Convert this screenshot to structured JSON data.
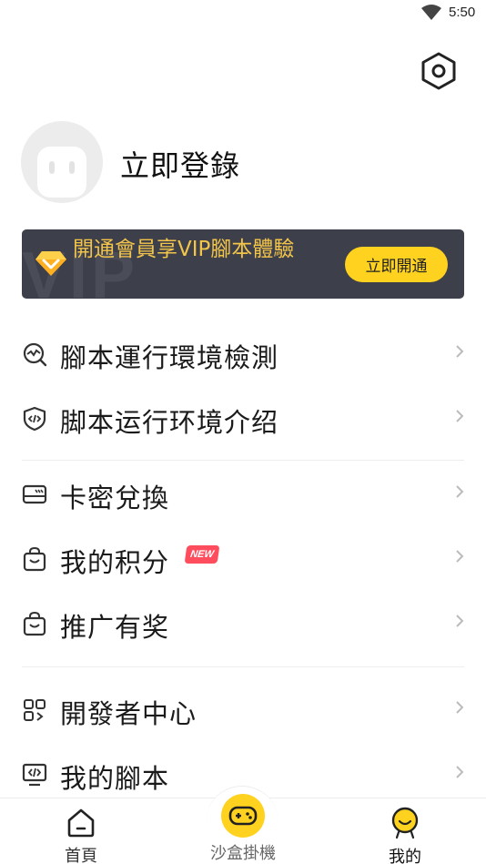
{
  "status_bar": {
    "time": "5:50"
  },
  "profile": {
    "login_label": "立即登錄"
  },
  "vip_banner": {
    "watermark": "VIP",
    "text": "開通會員享VIP腳本體驗",
    "button_label": "立即開通"
  },
  "menu": {
    "items": [
      {
        "label": "腳本運行環境檢測",
        "icon": "env-check-icon"
      },
      {
        "label": "脚本运行环境介绍",
        "icon": "shield-code-icon"
      },
      {
        "label": "卡密兌換",
        "icon": "card-icon"
      },
      {
        "label": "我的积分",
        "icon": "bag-icon",
        "badge": "NEW"
      },
      {
        "label": "推广有奖",
        "icon": "bag-icon"
      },
      {
        "label": "開發者中心",
        "icon": "grid-icon"
      },
      {
        "label": "我的腳本",
        "icon": "monitor-code-icon"
      }
    ]
  },
  "bottom_nav": {
    "items": [
      {
        "label": "首頁",
        "icon": "home-icon"
      },
      {
        "label": "沙盒掛機",
        "icon": "gamepad-icon"
      },
      {
        "label": "我的",
        "icon": "smiley-icon"
      }
    ]
  },
  "colors": {
    "accent_yellow": "#ffd21f",
    "banner_bg": "#3d3f4a",
    "banner_text": "#f2c44a",
    "new_badge": "#ff4d5e"
  }
}
